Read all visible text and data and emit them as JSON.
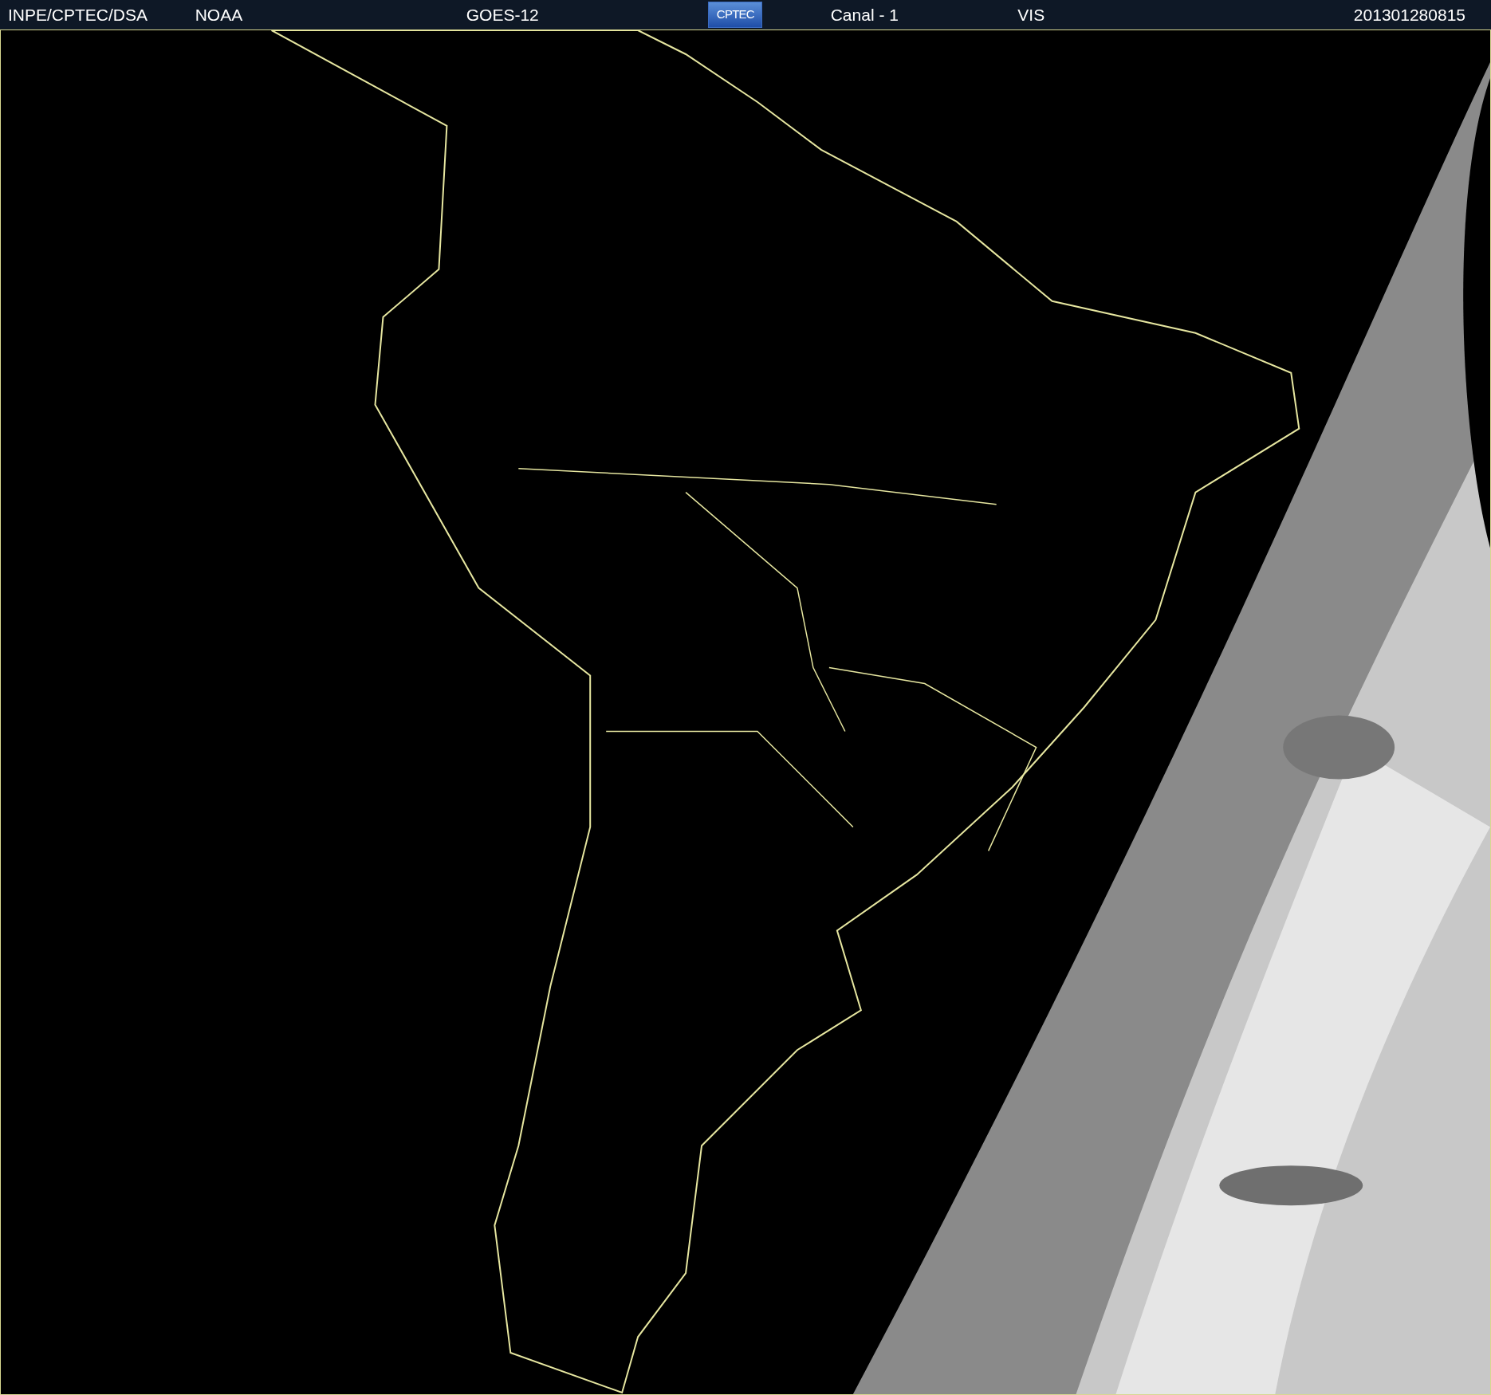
{
  "header": {
    "items": [
      {
        "kind": "text",
        "text": "INPE/CPTEC/DSA"
      },
      {
        "kind": "text",
        "text": "NOAA"
      },
      {
        "kind": "text",
        "text": "GOES-12"
      },
      {
        "kind": "logo",
        "text": "CPTEC"
      },
      {
        "kind": "text",
        "text": "Canal - 1"
      },
      {
        "kind": "text",
        "text": "VIS"
      },
      {
        "kind": "text",
        "text": "201301280815"
      }
    ]
  }
}
